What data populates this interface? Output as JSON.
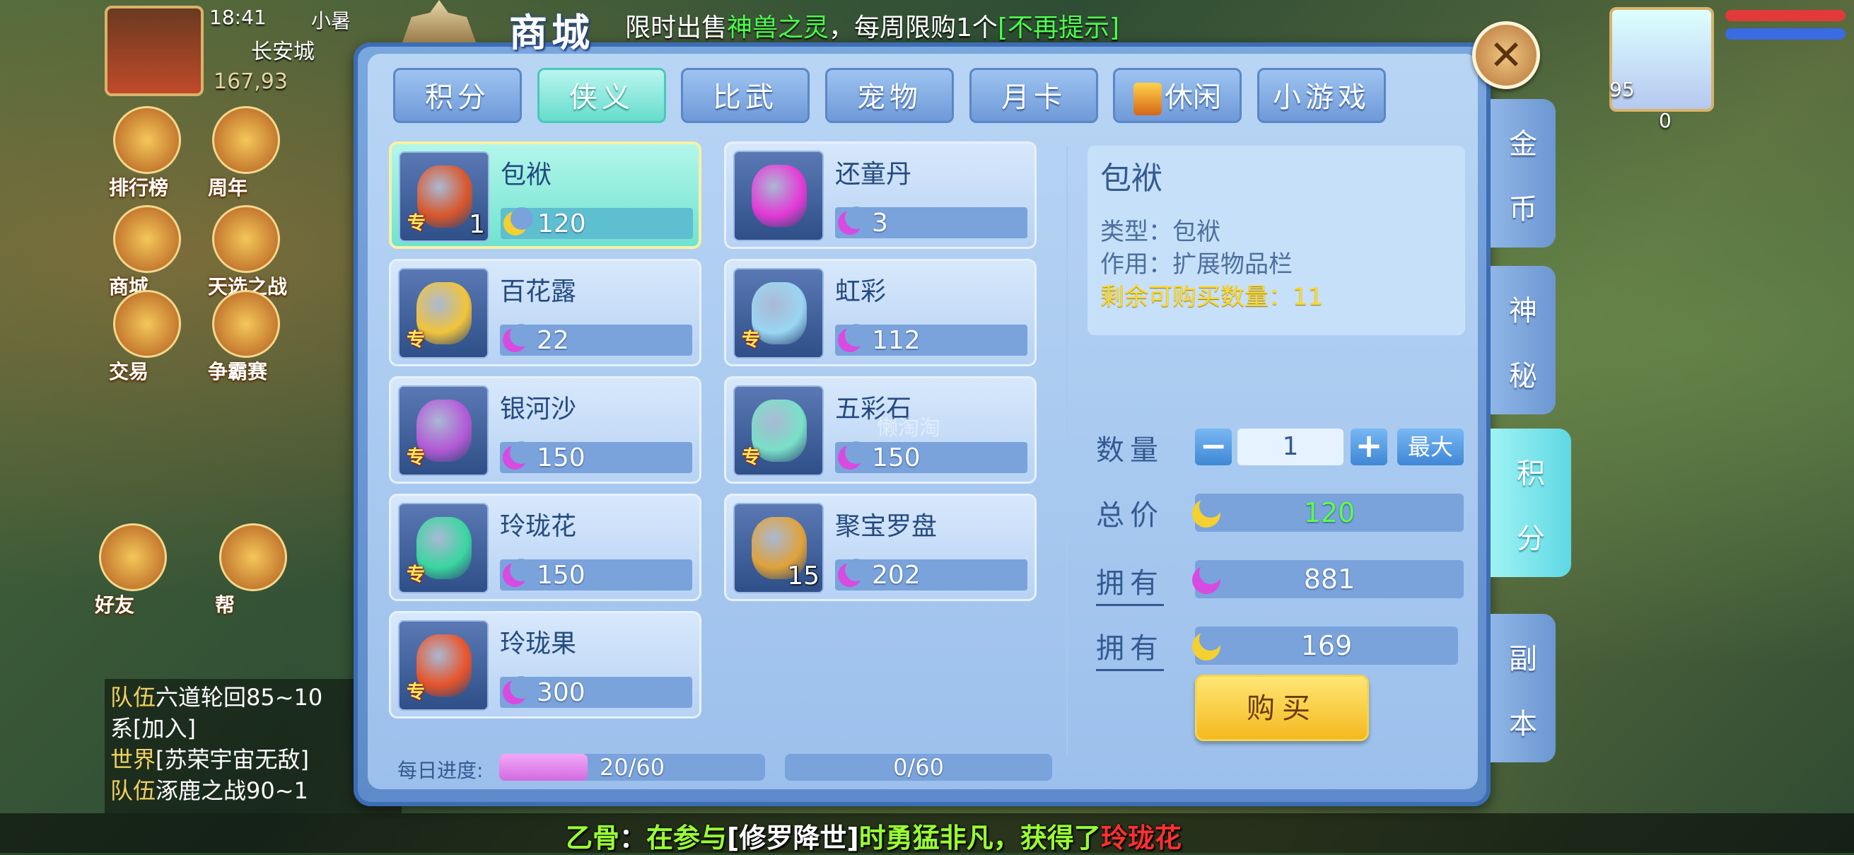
{
  "hud": {
    "time": "18:41",
    "player_name": "小暑",
    "city": "长安城",
    "coords": "167,93",
    "left_icons": [
      "排行榜",
      "周年",
      "商城",
      "天选之战",
      "交易",
      "争霸赛",
      "好友",
      "帮"
    ],
    "right_numbers": [
      "95",
      "0"
    ]
  },
  "chat": [
    {
      "channel": "队伍",
      "text": "六道轮回85~10"
    },
    {
      "channel": "",
      "text": "系[加入]"
    },
    {
      "channel": "世界",
      "text": "[苏荣宇宙无敌]"
    },
    {
      "channel": "队伍",
      "text": "涿鹿之战90~1"
    }
  ],
  "banner": {
    "name": "乙骨",
    "sep": "：",
    "text1": "在参与",
    "event": "[修罗降世]",
    "text2": "时勇猛非凡，获得了",
    "reward": "玲珑花"
  },
  "shop": {
    "title": "商城",
    "notice_prefix": "限时出售",
    "notice_item": "神兽之灵",
    "notice_mid": "，每周限购1个",
    "notice_link": "[不再提示]",
    "close_icon": "close-icon",
    "tabs": [
      {
        "label": "积分",
        "active": false
      },
      {
        "label": "侠义",
        "active": true
      },
      {
        "label": "比武",
        "active": false
      },
      {
        "label": "宠物",
        "active": false
      },
      {
        "label": "月卡",
        "active": false
      },
      {
        "label": "休闲",
        "active": false,
        "icon": "gift-icon"
      },
      {
        "label": "小游戏",
        "active": false
      }
    ],
    "side_tabs": [
      {
        "label": "金币",
        "active": false
      },
      {
        "label": "神秘",
        "active": false
      },
      {
        "label": "积分",
        "active": true
      },
      {
        "label": "副本",
        "active": false
      }
    ],
    "items": [
      {
        "name": "包袱",
        "price": "120",
        "qty": "1",
        "tag": "专",
        "active": true,
        "art": "#d9562a"
      },
      {
        "name": "还童丹",
        "price": "3",
        "qty": "",
        "tag": "",
        "active": false,
        "art": "#e43ad6"
      },
      {
        "name": "百花露",
        "price": "22",
        "qty": "",
        "tag": "专",
        "active": false,
        "art": "#f2c43a"
      },
      {
        "name": "虹彩",
        "price": "112",
        "qty": "",
        "tag": "专",
        "active": false,
        "art": "#9ad6f2"
      },
      {
        "name": "银河沙",
        "price": "150",
        "qty": "",
        "tag": "专",
        "active": false,
        "art": "#b35ad6"
      },
      {
        "name": "五彩石",
        "price": "150",
        "qty": "",
        "tag": "专",
        "active": false,
        "art": "#7ae0c8"
      },
      {
        "name": "玲珑花",
        "price": "150",
        "qty": "",
        "tag": "专",
        "active": false,
        "art": "#3ad6a0"
      },
      {
        "name": "聚宝罗盘",
        "price": "202",
        "qty": "15",
        "tag": "",
        "active": false,
        "art": "#e0a23a"
      },
      {
        "name": "玲珑果",
        "price": "300",
        "qty": "",
        "tag": "专",
        "active": false,
        "art": "#e8542a"
      }
    ],
    "info": {
      "title": "包袱",
      "type_line": "类型：包袱",
      "effect_line": "作用：扩展物品栏",
      "remain_line": "剩余可购买数量：11"
    },
    "purchase": {
      "qty_label": "数量",
      "qty_value": "1",
      "minus": "−",
      "plus": "+",
      "max": "最大",
      "total_label": "总价",
      "total_value": "120",
      "own_label": "拥有",
      "own_pink": "881",
      "own_gold": "169",
      "buy_label": "购买"
    },
    "progress": {
      "label": "每日进度:",
      "text1": "20/60",
      "value1": 20,
      "max1": 60,
      "text2": "0/60",
      "value2": 0,
      "max2": 60
    },
    "watermark": "懒淘淘"
  },
  "colors": {
    "accent_teal": "#66dccd",
    "pink_currency": "#d84be0",
    "gold_currency": "#f4d030",
    "remain_text": "#ffd827",
    "total_green": "#5cff4c"
  }
}
